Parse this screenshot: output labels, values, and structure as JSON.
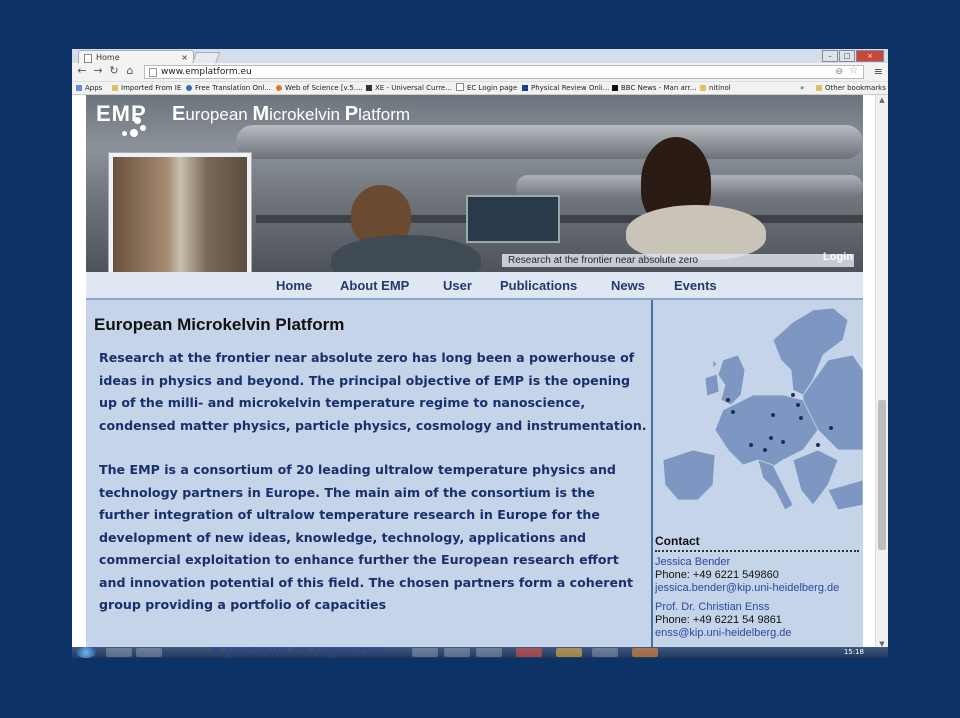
{
  "browser": {
    "tab_title": "Home",
    "tab_close": "×",
    "url": "www.emplatform.eu",
    "window_controls": [
      "–",
      "□",
      "×"
    ],
    "bookmarks": [
      {
        "label": "Apps",
        "icon": "apps-grid-icon",
        "color": "#6a8bd4"
      },
      {
        "label": "Imported From IE",
        "icon": "folder-icon",
        "color": "#e2c064"
      },
      {
        "label": "Free Translation Onl...",
        "icon": "globe-icon",
        "color": "#3a6ab8"
      },
      {
        "label": "Web of Science [v.5....",
        "icon": "wos-icon",
        "color": "#e07a28"
      },
      {
        "label": "XE - Universal Curre...",
        "icon": "xe-icon",
        "color": "#333333"
      },
      {
        "label": "EC Login page",
        "icon": "page-icon",
        "color": "#888888"
      },
      {
        "label": "Physical Review Onli...",
        "icon": "aps-icon",
        "color": "#1a3e8a"
      },
      {
        "label": "BBC News - Man arr...",
        "icon": "bbc-icon",
        "color": "#111111"
      },
      {
        "label": "nitinol",
        "icon": "folder-icon",
        "color": "#e2c064"
      },
      {
        "label": "»",
        "icon": "",
        "color": ""
      },
      {
        "label": "Other bookmarks",
        "icon": "folder-icon",
        "color": "#e2c064"
      }
    ]
  },
  "site": {
    "logo": "EMP",
    "title_parts": [
      "E",
      "uropean ",
      "M",
      "icrokelvin ",
      "P",
      "latform"
    ],
    "tagline": "Research at the frontier near absolute zero",
    "login": "Login",
    "nav": [
      "Home",
      "About EMP",
      "User",
      "Publications",
      "News",
      "Events"
    ],
    "heading": "European Microkelvin Platform",
    "paragraphs": [
      "Research at the frontier near absolute zero has long been a powerhouse of ideas in physics and beyond. The principal objective of EMP is the opening up of the milli- and microkelvin temperature regime to nanoscience, condensed matter physics, particle physics, cosmology and instrumentation.",
      "The EMP is a consortium of 20 leading ultralow temperature physics and technology partners in Europe.  The main aim of the consortium is the further integration of ultralow temperature research in Europe for the development of new ideas, knowledge, technology, applications and commercial exploitation to enhance further the European research effort and innovation potential of this field.  The chosen partners form a coherent group providing a portfolio of capacities"
    ],
    "contact": {
      "heading": "Contact",
      "people": [
        {
          "name": "Jessica Bender",
          "phone": "Phone: +49 6221 549860",
          "email": "jessica.bender@kip.uni-heidelberg.de"
        },
        {
          "name": "Prof. Dr. Christian Enss",
          "phone": "Phone: +49 6221 54 9861",
          "email": "enss@kip.uni-heidelberg.de"
        }
      ]
    }
  },
  "taskbar": {
    "clock": "15:18",
    "overlay_text": "a portfolio of capacities"
  },
  "colors": {
    "slide_background": "#0d3266",
    "page_background": "#c5d4e9",
    "nav_text": "#243a6b",
    "body_text": "#1a2f6b",
    "map_land": "#7e97c2",
    "link": "#2a48a0"
  }
}
